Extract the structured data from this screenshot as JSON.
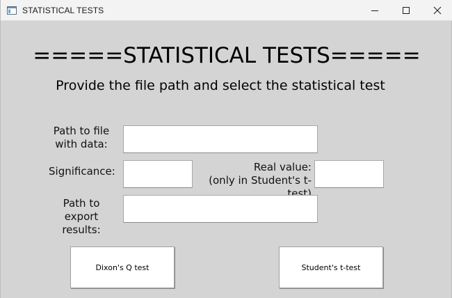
{
  "window": {
    "title": "STATISTICAL TESTS",
    "icons": {
      "app": "app-window-icon",
      "minimize": "minimize-icon",
      "maximize": "maximize-icon",
      "close": "close-icon"
    }
  },
  "main": {
    "heading": "=====STATISTICAL TESTS=====",
    "subheading": "Provide the file path and select the statistical test"
  },
  "form": {
    "data_path": {
      "label_line1": "Path to file",
      "label_line2": "with data:",
      "value": ""
    },
    "significance": {
      "label": "Significance:",
      "value": ""
    },
    "real_value": {
      "label_line1": "Real value:",
      "label_line2": "(only in Student's t-test)",
      "value": ""
    },
    "export_path": {
      "label_line1": "Path to",
      "label_line2": "export results:",
      "value": ""
    }
  },
  "buttons": {
    "dixon": "Dixon's Q test",
    "student": "Student's t-test"
  },
  "colors": {
    "background": "#d4d4d4",
    "titlebar": "#f3f3f3",
    "field": "#ffffff"
  }
}
